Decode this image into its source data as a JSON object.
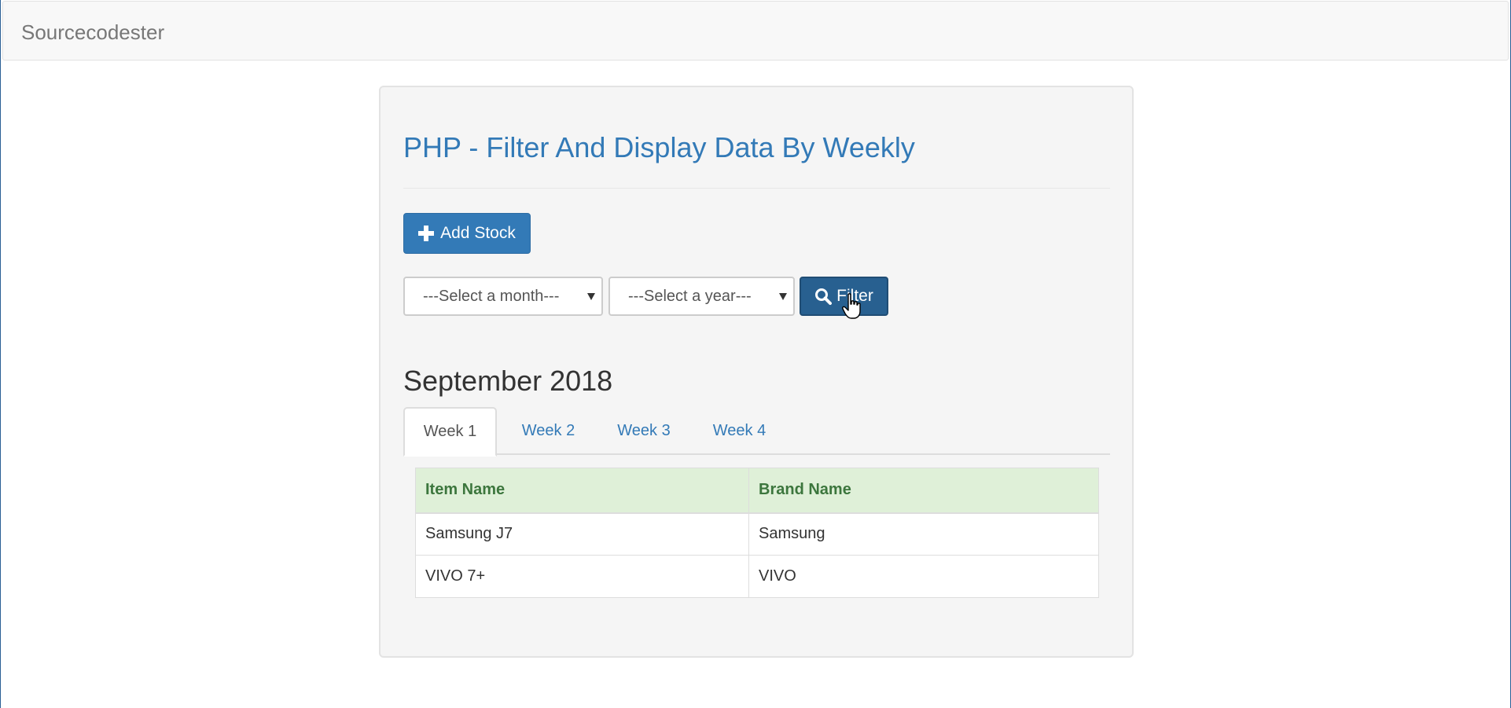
{
  "navbar": {
    "brand": "Sourcecodester"
  },
  "panel": {
    "title": "PHP - Filter And Display Data By Weekly",
    "add_button_label": "Add Stock",
    "filter": {
      "month_select": "---Select a month---",
      "year_select": "---Select a year---",
      "button_label": "Filter"
    },
    "period_heading": "September 2018",
    "tabs": [
      {
        "label": "Week 1",
        "active": true
      },
      {
        "label": "Week 2",
        "active": false
      },
      {
        "label": "Week 3",
        "active": false
      },
      {
        "label": "Week 4",
        "active": false
      }
    ],
    "table": {
      "headers": [
        "Item Name",
        "Brand Name"
      ],
      "rows": [
        [
          "Samsung J7",
          "Samsung"
        ],
        [
          "VIVO 7+",
          "VIVO"
        ]
      ]
    }
  },
  "colors": {
    "primary": "#337ab7",
    "primary_dark": "#286090",
    "table_header_bg": "#dff0d8",
    "table_header_text": "#3c763d"
  },
  "icons": {
    "add": "plus-icon",
    "filter": "search-icon",
    "cursor": "hand-pointer-icon"
  }
}
